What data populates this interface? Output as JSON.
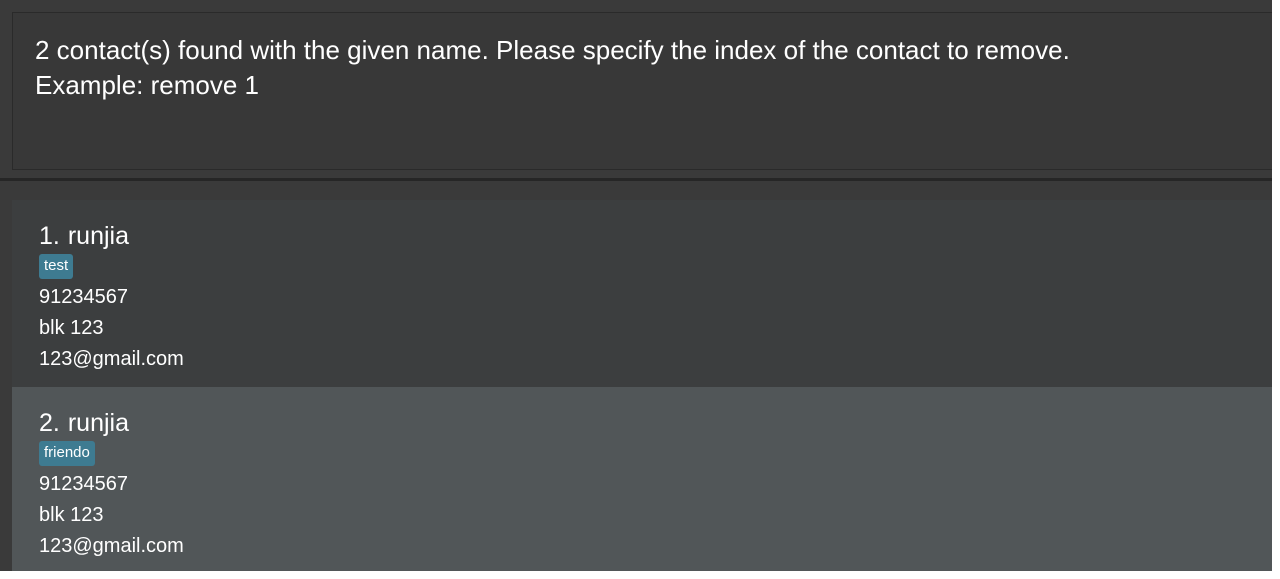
{
  "result_display": {
    "lines": [
      "2 contact(s) found with the given name. Please specify the index of the contact to remove.",
      "Example: remove 1"
    ]
  },
  "persons": [
    {
      "index": "1.",
      "name": "runjia",
      "tags": [
        "test"
      ],
      "phone": "91234567",
      "address": "blk 123",
      "email": "123@gmail.com"
    },
    {
      "index": "2.",
      "name": "runjia",
      "tags": [
        "friendo"
      ],
      "phone": "91234567",
      "address": "blk 123",
      "email": "123@gmail.com"
    }
  ],
  "colors": {
    "result_bg": "#383838",
    "card_odd_bg": "#3c3e3f",
    "card_even_bg": "#515658",
    "tag_bg": "#3e7b91"
  }
}
